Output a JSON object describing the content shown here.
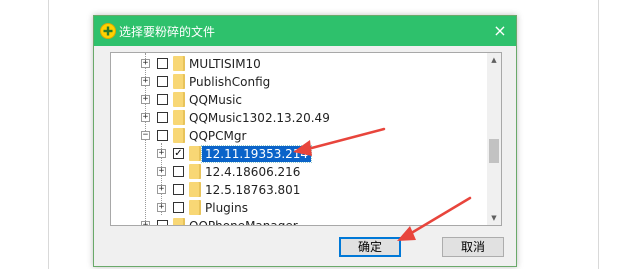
{
  "dialog": {
    "title": "选择要粉碎的文件",
    "close_glyph": "×"
  },
  "tree": {
    "items": [
      {
        "label": "MULTISIM10",
        "checked": false,
        "expanded": false,
        "level": 0
      },
      {
        "label": "PublishConfig",
        "checked": false,
        "expanded": false,
        "level": 0
      },
      {
        "label": "QQMusic",
        "checked": false,
        "expanded": false,
        "level": 0
      },
      {
        "label": "QQMusic1302.13.20.49",
        "checked": false,
        "expanded": false,
        "level": 0
      },
      {
        "label": "QQPCMgr",
        "checked": false,
        "expanded": true,
        "level": 0
      },
      {
        "label": "12.11.19353.214",
        "checked": true,
        "expanded": false,
        "level": 1,
        "selected": true
      },
      {
        "label": "12.4.18606.216",
        "checked": false,
        "expanded": false,
        "level": 1
      },
      {
        "label": "12.5.18763.801",
        "checked": false,
        "expanded": false,
        "level": 1
      },
      {
        "label": "Plugins",
        "checked": false,
        "expanded": false,
        "level": 1
      },
      {
        "label": "QQPhoneManager",
        "checked": false,
        "expanded": false,
        "level": 0
      }
    ],
    "expander_collapsed": "+",
    "expander_expanded": "−",
    "check_glyph": "✓"
  },
  "scrollbar": {
    "up_glyph": "▲",
    "down_glyph": "▼"
  },
  "buttons": {
    "ok_label": "确定",
    "cancel_label": "取消"
  },
  "colors": {
    "titlebar": "#2ec16c",
    "selection": "#0a63c9",
    "annotation_arrow": "#e8453c",
    "folder": "#f8d775"
  }
}
